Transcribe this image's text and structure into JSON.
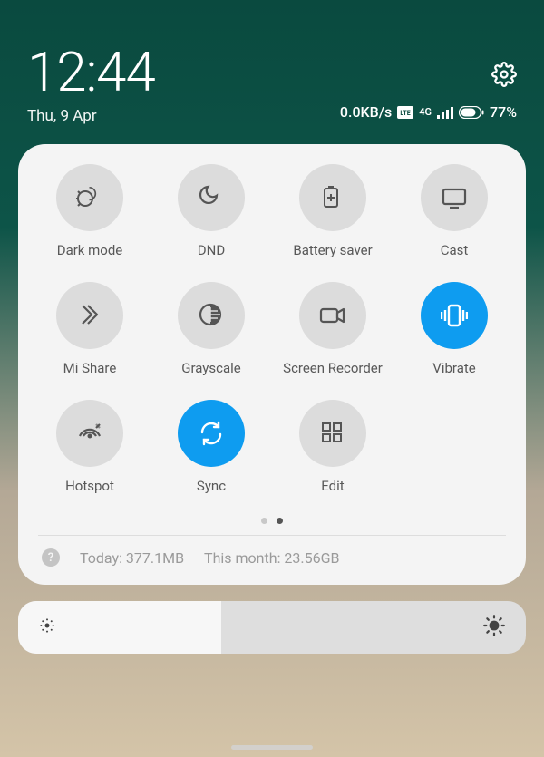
{
  "header": {
    "time": "12:44",
    "date": "Thu, 9 Apr"
  },
  "status": {
    "data_speed": "0.0KB/s",
    "network_badge": "VoLTE",
    "network_type": "4G",
    "battery_percent": "77%"
  },
  "tiles": [
    {
      "name": "dark-mode",
      "label": "Dark mode",
      "icon": "dark-mode-icon",
      "active": false
    },
    {
      "name": "dnd",
      "label": "DND",
      "icon": "moon-icon",
      "active": false
    },
    {
      "name": "battery-saver",
      "label": "Battery saver",
      "icon": "battery-plus-icon",
      "active": false
    },
    {
      "name": "cast",
      "label": "Cast",
      "icon": "cast-icon",
      "active": false
    },
    {
      "name": "mi-share",
      "label": "Mi Share",
      "icon": "mi-share-icon",
      "active": false
    },
    {
      "name": "grayscale",
      "label": "Grayscale",
      "icon": "grayscale-icon",
      "active": false
    },
    {
      "name": "screen-recorder",
      "label": "Screen Recorder",
      "icon": "camcorder-icon",
      "active": false
    },
    {
      "name": "vibrate",
      "label": "Vibrate",
      "icon": "vibrate-icon",
      "active": true
    },
    {
      "name": "hotspot",
      "label": "Hotspot",
      "icon": "hotspot-icon",
      "active": false
    },
    {
      "name": "sync",
      "label": "Sync",
      "icon": "sync-icon",
      "active": true
    },
    {
      "name": "edit",
      "label": "Edit",
      "icon": "grid-icon",
      "active": false
    }
  ],
  "pager": {
    "pages": 2,
    "current": 1
  },
  "data_usage": {
    "today_label": "Today: 377.1MB",
    "month_label": "This month: 23.56GB"
  },
  "brightness": {
    "level": 0.4
  }
}
